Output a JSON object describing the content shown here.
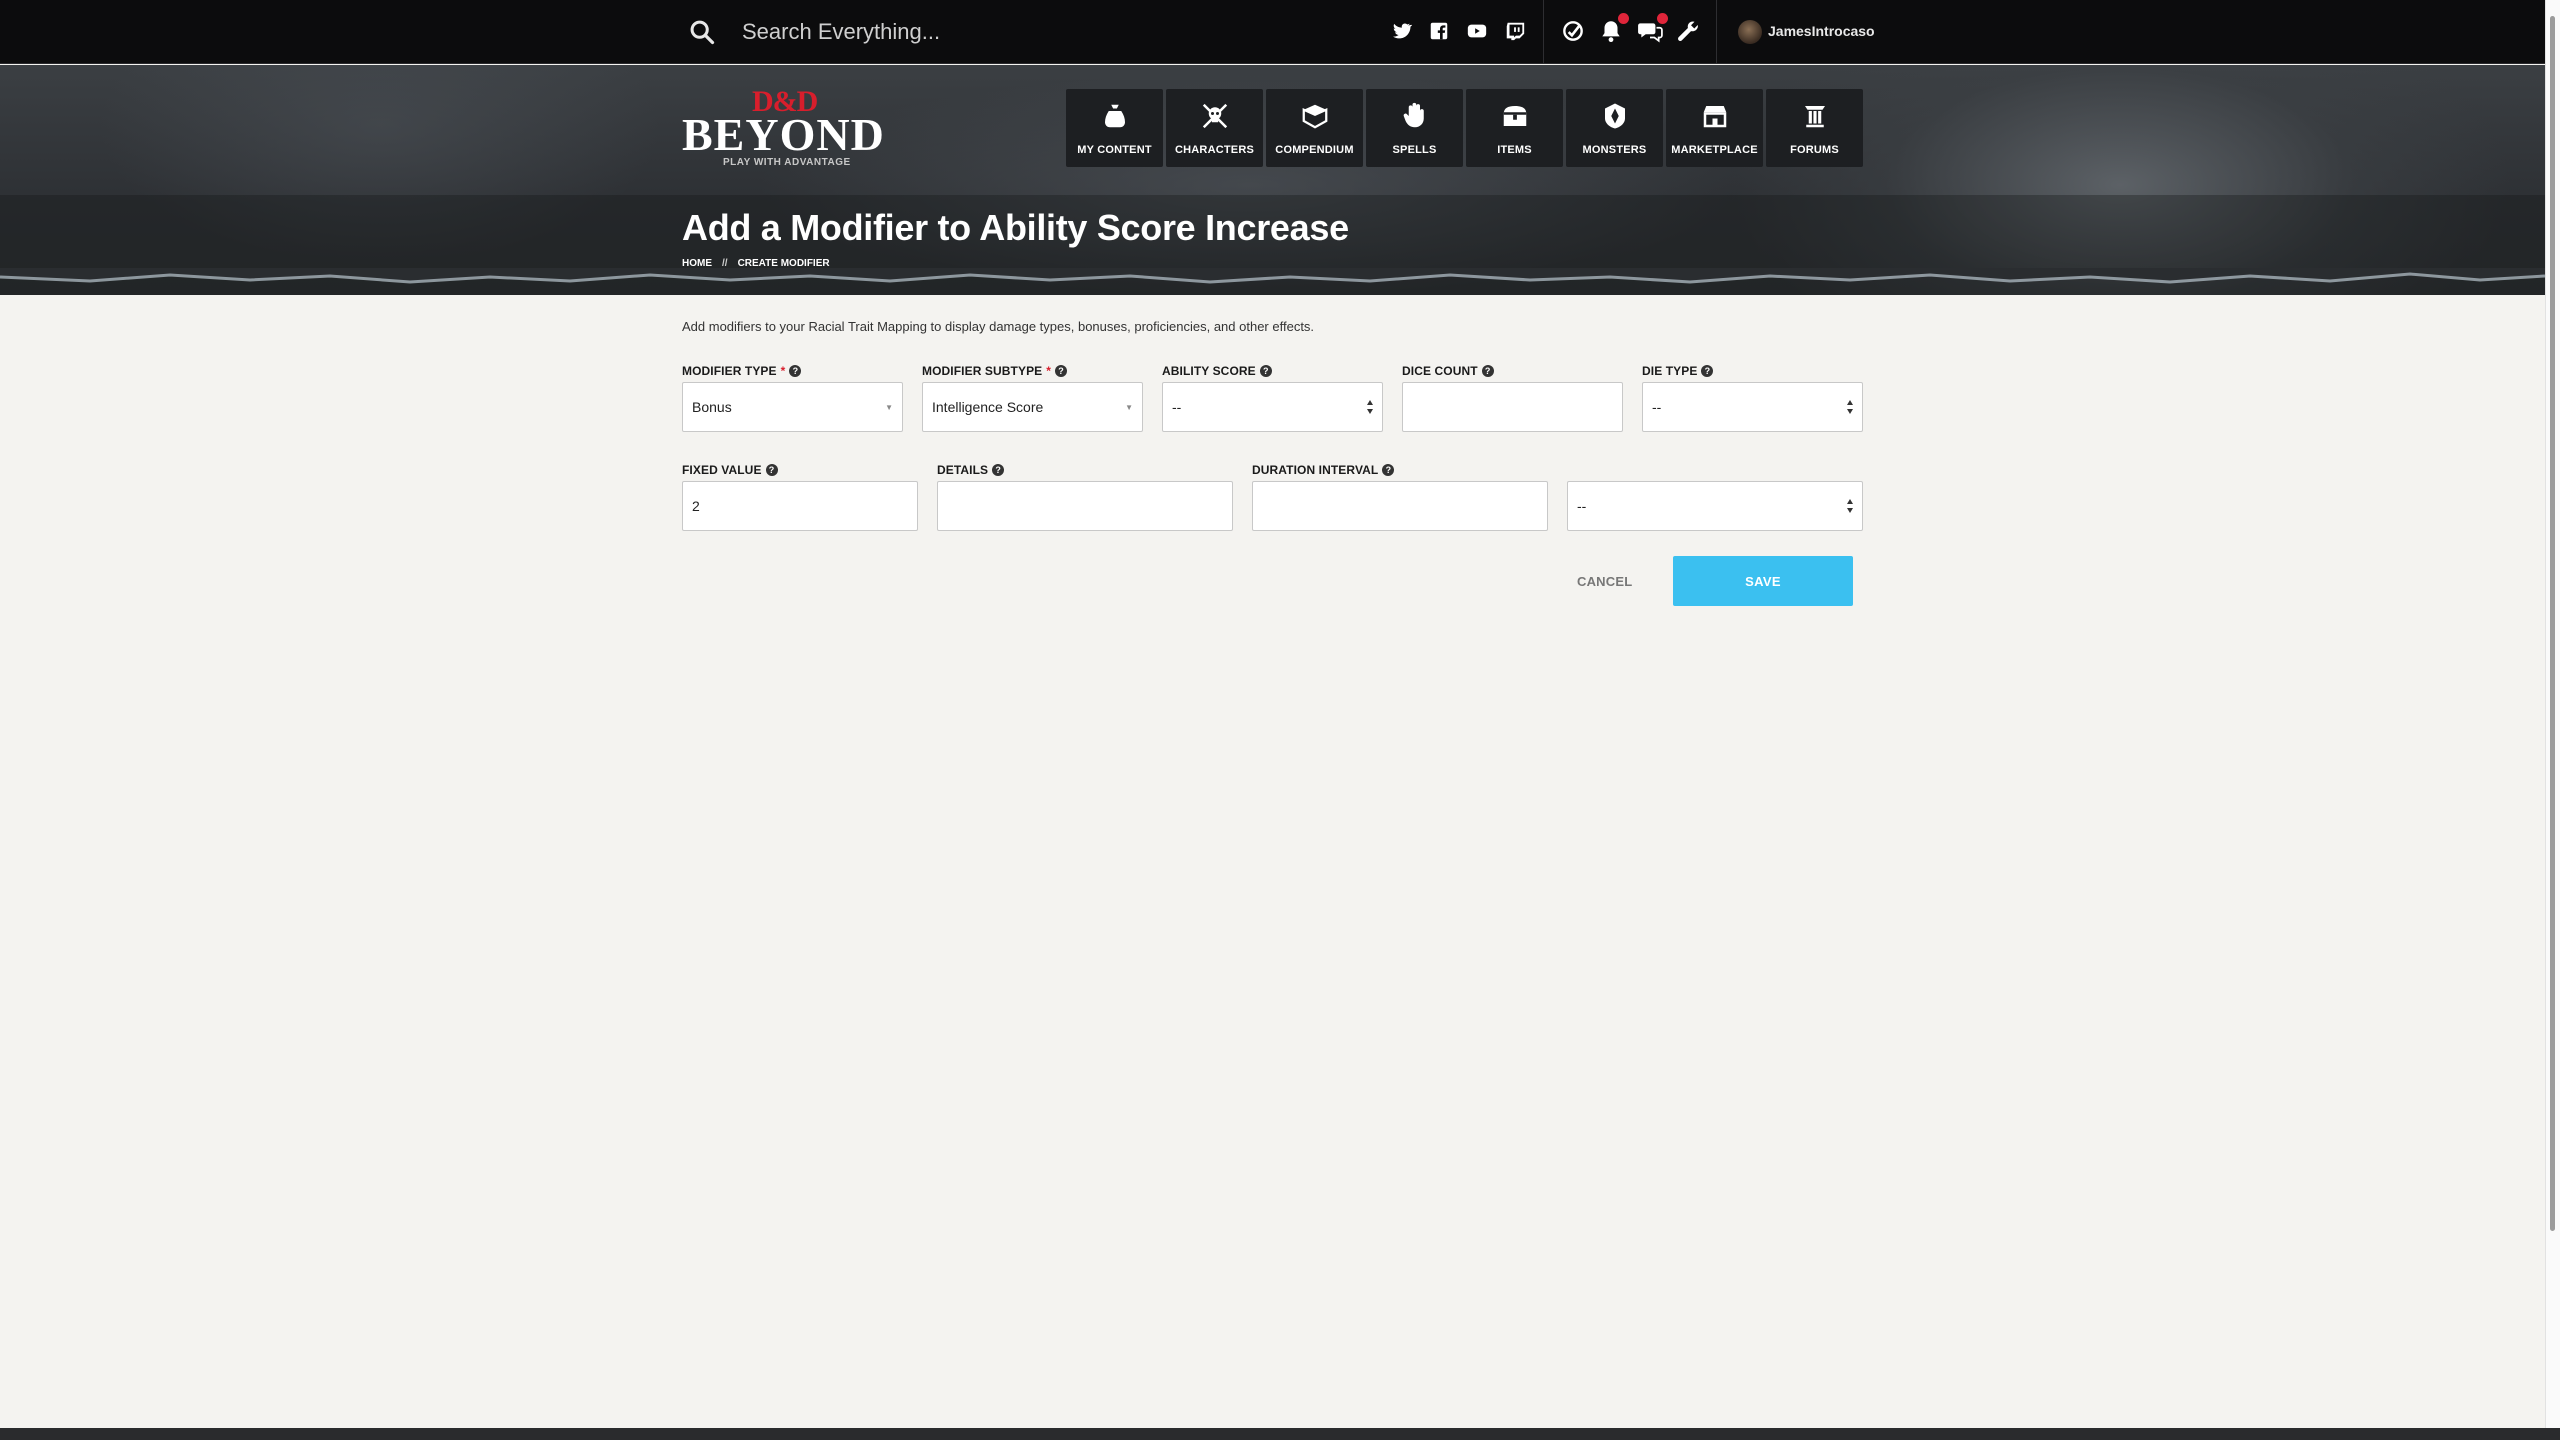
{
  "search": {
    "placeholder": "Search Everything..."
  },
  "topbar": {
    "social_icons": [
      "twitter-icon",
      "facebook-icon",
      "youtube-icon",
      "twitch-icon"
    ],
    "util_icons": [
      "dndbeyond-icon",
      "notification-bell-icon",
      "chat-icon",
      "wrench-icon"
    ],
    "username": "JamesIntrocaso"
  },
  "logo": {
    "mark": "D&D",
    "wordmark": "BEYOND",
    "tagline": "PLAY WITH ADVANTAGE"
  },
  "nav": {
    "items": [
      {
        "label": "MY CONTENT",
        "icon": "bag-icon"
      },
      {
        "label": "CHARACTERS",
        "icon": "skull-crossed-swords-icon"
      },
      {
        "label": "COMPENDIUM",
        "icon": "book-icon"
      },
      {
        "label": "SPELLS",
        "icon": "hand-spell-icon"
      },
      {
        "label": "ITEMS",
        "icon": "chest-icon"
      },
      {
        "label": "MONSTERS",
        "icon": "monster-icon"
      },
      {
        "label": "MARKETPLACE",
        "icon": "storefront-icon"
      },
      {
        "label": "FORUMS",
        "icon": "pillar-icon"
      }
    ]
  },
  "page": {
    "title": "Add a Modifier to Ability Score Increase",
    "breadcrumb": [
      "HOME",
      "//",
      "CREATE MODIFIER"
    ],
    "intro": "Add modifiers to your Racial Trait Mapping to display damage types, bonuses, proficiencies, and other effects."
  },
  "form": {
    "modifier_type": {
      "label": "MODIFIER TYPE",
      "value": "Bonus"
    },
    "modifier_subtype": {
      "label": "MODIFIER SUBTYPE",
      "value": "Intelligence Score"
    },
    "ability_score": {
      "label": "ABILITY SCORE",
      "value": "--"
    },
    "dice_count": {
      "label": "DICE COUNT",
      "value": ""
    },
    "die_type": {
      "label": "DIE TYPE",
      "value": "--"
    },
    "fixed_value": {
      "label": "FIXED VALUE",
      "value": "2"
    },
    "details": {
      "label": "DETAILS",
      "value": ""
    },
    "duration_interval": {
      "label": "DURATION INTERVAL",
      "value": ""
    },
    "duration_unit": {
      "value": "--"
    },
    "required_mark": "*",
    "help_glyph": "?"
  },
  "actions": {
    "cancel": "CANCEL",
    "save": "SAVE"
  },
  "colors": {
    "accent": "#3bc0f0",
    "brand_red": "#d81e2c",
    "topbar": "#0c0c0d"
  }
}
